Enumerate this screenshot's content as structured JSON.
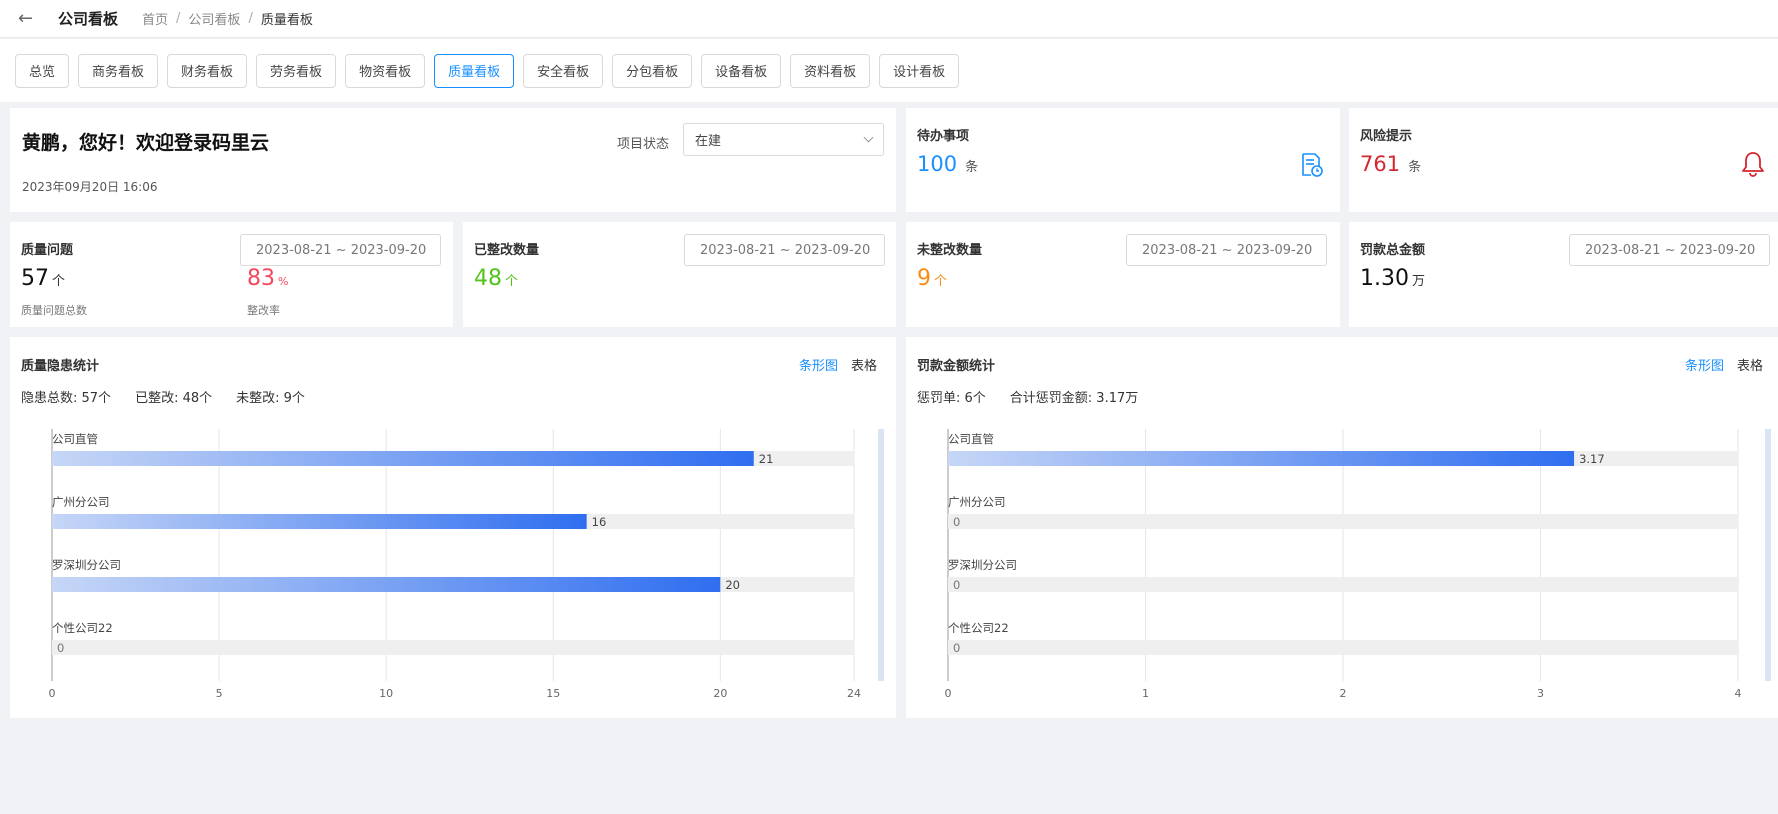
{
  "header": {
    "back_icon": "←",
    "app_title": "公司看板",
    "breadcrumb": [
      "首页",
      "公司看板",
      "质量看板"
    ]
  },
  "tabs": [
    {
      "label": "总览",
      "active": false
    },
    {
      "label": "商务看板",
      "active": false
    },
    {
      "label": "财务看板",
      "active": false
    },
    {
      "label": "劳务看板",
      "active": false
    },
    {
      "label": "物资看板",
      "active": false
    },
    {
      "label": "质量看板",
      "active": true
    },
    {
      "label": "安全看板",
      "active": false
    },
    {
      "label": "分包看板",
      "active": false
    },
    {
      "label": "设备看板",
      "active": false
    },
    {
      "label": "资料看板",
      "active": false
    },
    {
      "label": "设计看板",
      "active": false
    }
  ],
  "welcome": {
    "title": "黄鹏，您好！欢迎登录码里云",
    "datetime": "2023年09月20日 16:06",
    "status_label": "项目状态",
    "status_value": "在建"
  },
  "todo": {
    "title": "待办事项",
    "count": "100",
    "unit": "条",
    "icon": "document-clock-icon"
  },
  "risk": {
    "title": "风险提示",
    "count": "761",
    "unit": "条",
    "icon": "bell-icon"
  },
  "stats": [
    {
      "title": "质量问题",
      "date_range": "2023-08-21 ~ 2023-09-20",
      "value": "57",
      "unit": "个",
      "caption": "质量问题总数",
      "rate_value": "83",
      "rate_unit": "%",
      "rate_caption": "整改率"
    },
    {
      "title": "已整改数量",
      "date_range": "2023-08-21 ~ 2023-09-20",
      "value": "48",
      "unit": "个"
    },
    {
      "title": "未整改数量",
      "date_range": "2023-08-21 ~ 2023-09-20",
      "value": "9",
      "unit": "个"
    },
    {
      "title": "罚款总金额",
      "date_range": "2023-08-21 ~ 2023-09-20",
      "value": "1.30",
      "unit": "万"
    }
  ],
  "colors": {
    "primary": "#1890ff",
    "risk_red": "#d4262e",
    "rate_red": "#f5475b",
    "green": "#52c41a",
    "orange": "#fa8c16",
    "bar_blue": "#2f6ef0"
  },
  "left_panel": {
    "title": "质量隐患统计",
    "view_toggle": [
      "条形图",
      "表格"
    ],
    "summary": [
      "隐患总数:  57个",
      "已整改:  48个",
      "未整改:  9个"
    ]
  },
  "right_panel": {
    "title": "罚款金额统计",
    "view_toggle": [
      "条形图",
      "表格"
    ],
    "summary": [
      "惩罚单:  6个",
      "合计惩罚金额:  3.17万"
    ]
  },
  "chart_data": [
    {
      "type": "bar",
      "orientation": "horizontal",
      "categories": [
        "公司直管",
        "广州分公司",
        "罗深圳分公司",
        "个性公司22"
      ],
      "values": [
        21,
        16,
        20,
        0
      ],
      "xlim": [
        0,
        24
      ],
      "xticks": [
        0,
        5,
        10,
        15,
        20,
        24
      ],
      "grid": true
    },
    {
      "type": "bar",
      "orientation": "horizontal",
      "categories": [
        "公司直管",
        "广州分公司",
        "罗深圳分公司",
        "个性公司22"
      ],
      "values": [
        3.17,
        0,
        0,
        0
      ],
      "xlim": [
        0,
        4
      ],
      "xticks": [
        0,
        1,
        2,
        3,
        4
      ],
      "grid": true
    }
  ]
}
